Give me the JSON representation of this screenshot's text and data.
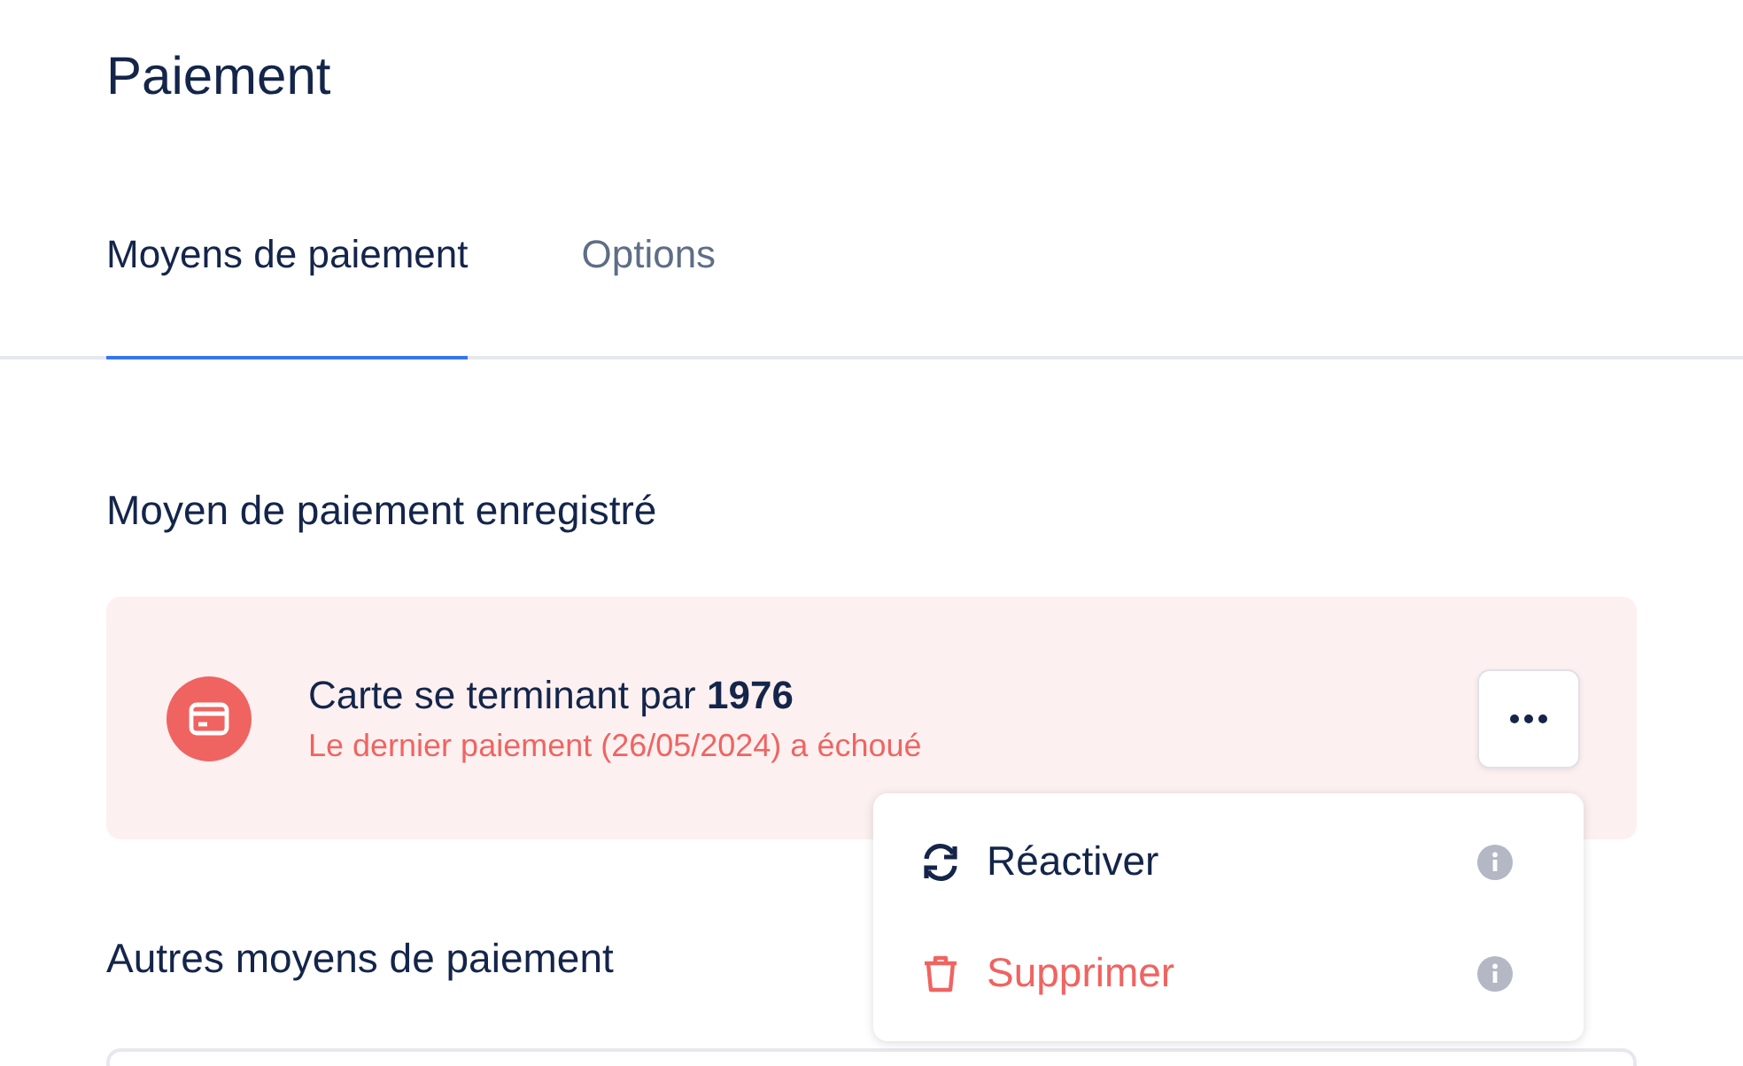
{
  "page_title": "Paiement",
  "tabs": [
    {
      "label": "Moyens de paiement",
      "selected": true
    },
    {
      "label": "Options",
      "selected": false
    }
  ],
  "saved_section": {
    "title": "Moyen de paiement enregistré",
    "card": {
      "failed": true,
      "title": "Carte se terminant par **1976**",
      "message": "Le dernier paiement (26/05/2024) a échoué",
      "menu": {
        "open": true,
        "items": [
          {
            "kind": "reactivate",
            "label": "Réactiver"
          },
          {
            "kind": "delete",
            "label": "Supprimer"
          }
        ]
      }
    }
  },
  "other_section": {
    "title": "Autres moyens de paiement"
  }
}
